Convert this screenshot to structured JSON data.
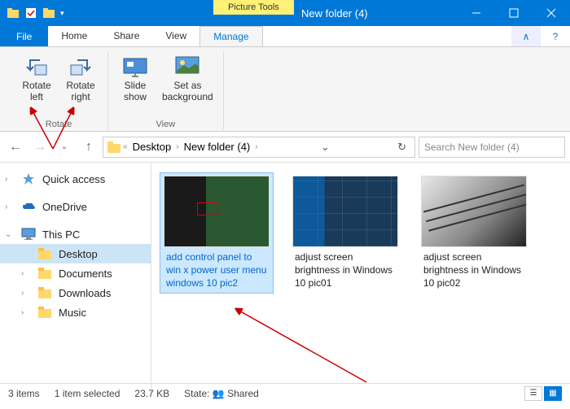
{
  "titlebar": {
    "context_tab": "Picture Tools",
    "title": "New folder (4)"
  },
  "menubar": {
    "file": "File",
    "tabs": [
      "Home",
      "Share",
      "View",
      "Manage"
    ],
    "active": 3
  },
  "ribbon": {
    "groups": [
      {
        "name": "Rotate",
        "buttons": [
          {
            "label": "Rotate\nleft",
            "icon": "rotate-left"
          },
          {
            "label": "Rotate\nright",
            "icon": "rotate-right"
          }
        ]
      },
      {
        "name": "View",
        "buttons": [
          {
            "label": "Slide\nshow",
            "icon": "slideshow"
          },
          {
            "label": "Set as\nbackground",
            "icon": "set-bg"
          }
        ]
      }
    ]
  },
  "address": {
    "segments": [
      "Desktop",
      "New folder (4)"
    ]
  },
  "search": {
    "placeholder": "Search New folder (4)"
  },
  "sidebar": {
    "items": [
      {
        "label": "Quick access",
        "icon": "star",
        "expandable": true
      },
      {
        "label": "OneDrive",
        "icon": "onedrive",
        "expandable": true
      },
      {
        "label": "This PC",
        "icon": "pc",
        "expandable": true,
        "expanded": true
      },
      {
        "label": "Desktop",
        "icon": "folder",
        "selected": true,
        "indent": true
      },
      {
        "label": "Documents",
        "icon": "folder",
        "indent": true,
        "expandable": true
      },
      {
        "label": "Downloads",
        "icon": "folder",
        "indent": true,
        "expandable": true
      },
      {
        "label": "Music",
        "icon": "folder",
        "indent": true,
        "expandable": true
      }
    ]
  },
  "files": [
    {
      "name": "add control panel to win x power user menu windows 10 pic2",
      "selected": true,
      "thumb": "th1"
    },
    {
      "name": "adjust screen brightness in Windows 10 pic01",
      "thumb": "th2"
    },
    {
      "name": "adjust screen brightness in Windows 10 pic02",
      "thumb": "th3"
    }
  ],
  "statusbar": {
    "count": "3 items",
    "selection": "1 item selected",
    "size": "23.7 KB",
    "state_label": "State:",
    "state_value": "Shared"
  }
}
